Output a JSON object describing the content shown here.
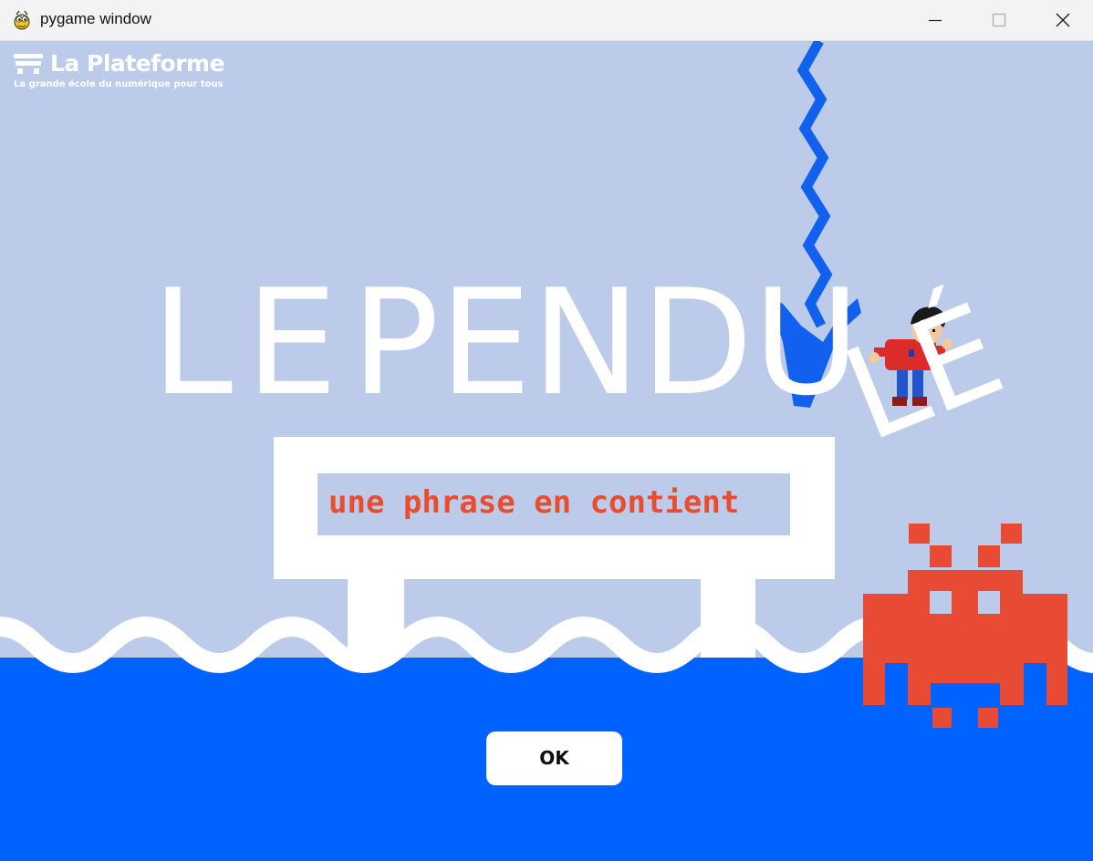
{
  "window": {
    "title": "pygame window",
    "app_icon": "pygame-snake-icon",
    "controls": [
      "minimize-icon",
      "maximize-icon",
      "close-icon"
    ]
  },
  "logo": {
    "name": "La Plateforme",
    "tagline": "La grande école du numérique pour tous"
  },
  "game_title": {
    "part1": "LE",
    "part2": "PENDU",
    "part3": "LÉ"
  },
  "phrase": "une phrase en contient",
  "ok_button": "OK",
  "colors": {
    "sky": "#bccbe9",
    "water": "#0062ff",
    "wave": "#ffffff",
    "invader": "#e84a33",
    "phrase_text": "#ea4c2d",
    "rope": "#0062ff",
    "board": "#ffffff"
  }
}
